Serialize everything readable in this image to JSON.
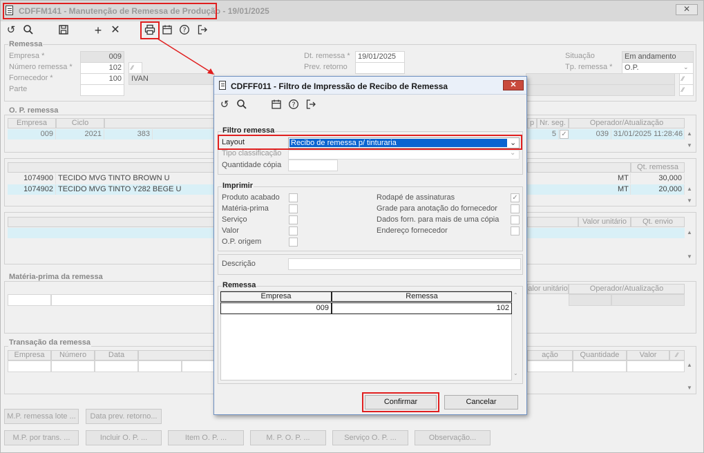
{
  "window": {
    "title": "CDFFM141 - Manutenção de Remessa de Produção - 19/01/2025",
    "close": "✕"
  },
  "toolbar": {
    "icons": [
      "undo-icon",
      "search-icon",
      "save-icon",
      "add-icon",
      "delete-icon",
      "print-icon",
      "calendar-icon",
      "help-icon",
      "exit-icon"
    ]
  },
  "remessa": {
    "section_title": "Remessa",
    "empresa_label": "Empresa *",
    "empresa_value": "009",
    "numero_label": "Número remessa *",
    "numero_value": "102",
    "fornecedor_label": "Fornecedor *",
    "fornecedor_value": "100",
    "fornecedor_name": "IVAN",
    "parte_label": "Parte",
    "dt_remessa_label": "Dt. remessa *",
    "dt_remessa_value": "19/01/2025",
    "prev_retorno_label": "Prev. retorno",
    "situacao_label": "Situação",
    "situacao_value": "Em andamento",
    "tp_remessa_label": "Tp. remessa *",
    "tp_remessa_value": "O.P."
  },
  "op_remessa": {
    "section_title": "O. P. remessa",
    "headers": {
      "empresa": "Empresa",
      "ciclo": "Ciclo",
      "nr_seg": "Nr. seg.",
      "operador": "Operador/Atualização",
      "p": "p"
    },
    "row": {
      "empresa": "009",
      "ciclo": "2021",
      "op": "383",
      "nr_seg": "5",
      "operador_code": "039",
      "atualizacao": "31/01/2025 11:28:46"
    }
  },
  "items": {
    "qt_header": "Qt. remessa",
    "rows": [
      {
        "code": "1074900",
        "desc": "TECIDO MVG TINTO BROWN U",
        "unit": "MT",
        "qt": "30,000"
      },
      {
        "code": "1074902",
        "desc": "TECIDO MVG TINTO Y282 BEGE U",
        "unit": "MT",
        "qt": "20,000"
      }
    ]
  },
  "envio": {
    "valor_unitario": "Valor unitário",
    "qt_envio": "Qt. envio"
  },
  "materia_prima": {
    "section_title": "Matéria-prima da remessa",
    "valor_unitario": "alor unitário",
    "operador": "Operador/Atualização"
  },
  "transacao": {
    "section_title": "Transação da remessa",
    "headers": [
      "Empresa",
      "Número",
      "Data"
    ],
    "acao": "ação",
    "quantidade": "Quantidade",
    "valor": "Valor"
  },
  "bottom_buttons": {
    "row1": [
      "M.P. remessa lote ...",
      "Data prev. retorno..."
    ],
    "row2": [
      "M.P. por trans. ...",
      "Incluir O. P. ...",
      "Item O. P. ...",
      "M. P. O. P. ...",
      "Serviço O. P. ...",
      "Observação..."
    ]
  },
  "dialog": {
    "title": "CDFFF011 - Filtro de Impressão de Recibo de Remessa",
    "close": "✕",
    "filtro": {
      "section_title": "Filtro remessa",
      "layout_label": "Layout",
      "layout_value": "Recibo de remessa p/ tinturaria",
      "tipo_label": "Tipo classificação",
      "qtd_label": "Quantidade cópia"
    },
    "imprimir": {
      "section_title": "Imprimir",
      "left": [
        "Produto acabado",
        "Matéria-prima",
        "Serviço",
        "Valor",
        "O.P. origem"
      ],
      "right": [
        "Rodapé de assinaturas",
        "Grade para anotação do fornecedor",
        "Dados forn. para mais de uma cópia",
        "Endereço fornecedor"
      ],
      "right_checked": [
        true,
        false,
        false,
        false
      ]
    },
    "descricao_label": "Descrição",
    "remessa": {
      "section_title": "Remessa",
      "col_empresa": "Empresa",
      "col_remessa": "Remessa",
      "empresa_value": "009",
      "remessa_value": "102"
    },
    "confirmar": "Confirmar",
    "cancelar": "Cancelar"
  },
  "colors": {
    "highlight": "#e01f1f",
    "selection": "#0a64d0",
    "row_select": "#d9f0f7"
  }
}
